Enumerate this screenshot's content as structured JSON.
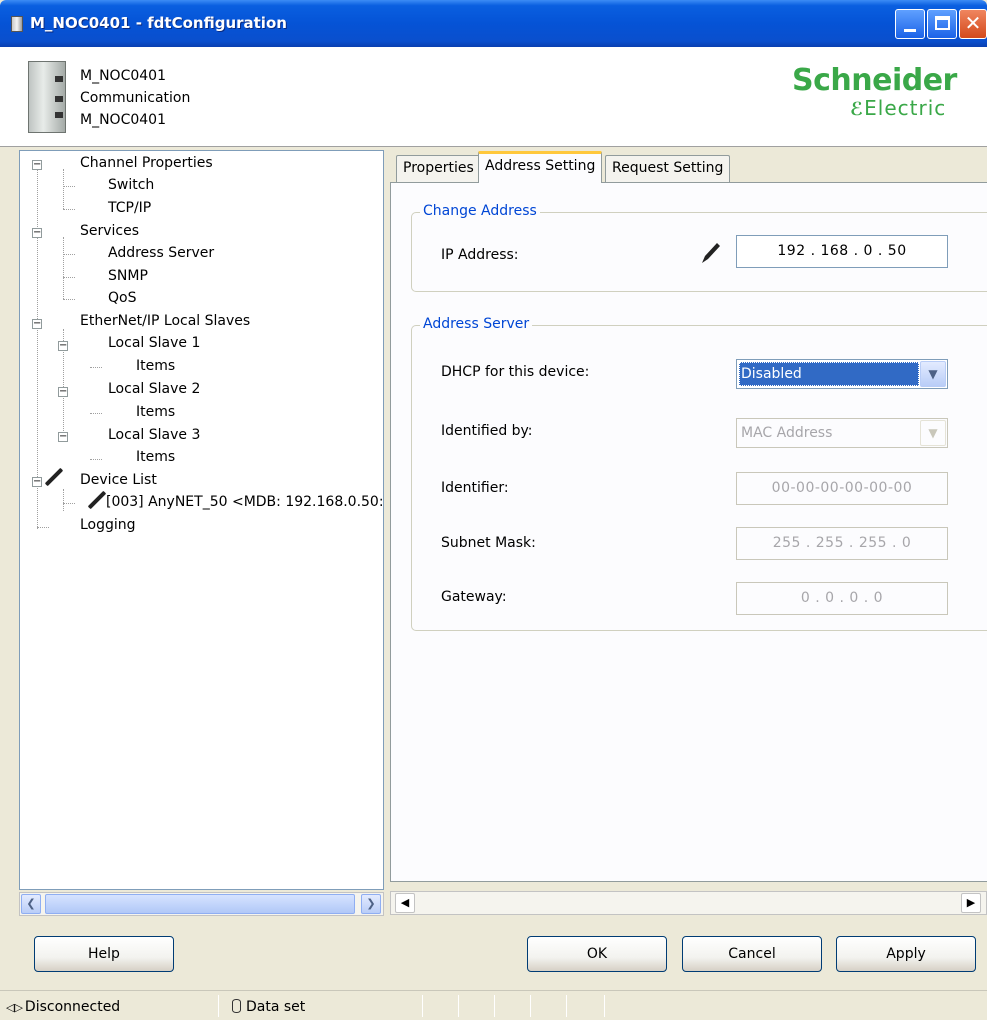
{
  "window": {
    "title": "M_NOC0401 - fdtConfiguration",
    "minimize_glyph": "_",
    "maximize_glyph": "□",
    "close_glyph": "✕"
  },
  "header": {
    "line1": "M_NOC0401",
    "line2": "Communication",
    "line3": "M_NOC0401",
    "logo_top": "Schneider",
    "logo_bottom": "Electric"
  },
  "tree": {
    "channel_properties": "Channel Properties",
    "switch": "Switch",
    "tcpip": "TCP/IP",
    "services": "Services",
    "address_server": "Address Server",
    "snmp": "SNMP",
    "qos": "QoS",
    "ethernetip_local_slaves": "EtherNet/IP Local Slaves",
    "local_slave_1": "Local Slave 1",
    "items_1": "Items",
    "local_slave_2": "Local Slave 2",
    "items_2": "Items",
    "local_slave_3": "Local Slave 3",
    "items_3": "Items",
    "device_list": "Device List",
    "device_003": "[003] AnyNET_50 <MDB: 192.168.0.50:",
    "logging": "Logging"
  },
  "tabs": {
    "properties": "Properties",
    "address_setting": "Address Setting",
    "request_setting": "Request Setting"
  },
  "change_address": {
    "group_title": "Change Address",
    "ip_label": "IP Address:",
    "ip_value": "192 . 168 . 0 . 50"
  },
  "address_server": {
    "group_title": "Address Server",
    "dhcp_label": "DHCP for this device:",
    "dhcp_value": "Disabled",
    "identified_by_label": "Identified by:",
    "identified_by_value": "MAC Address",
    "identifier_label": "Identifier:",
    "identifier_value": "00-00-00-00-00-00",
    "subnet_label": "Subnet Mask:",
    "subnet_value": "255 . 255 . 255 . 0",
    "gateway_label": "Gateway:",
    "gateway_value": "0 . 0 . 0 . 0"
  },
  "buttons": {
    "help": "Help",
    "ok": "OK",
    "cancel": "Cancel",
    "apply": "Apply"
  },
  "statusbar": {
    "connection": "Disconnected",
    "data": "Data set"
  },
  "icons": {
    "window": "fdt-window-icon",
    "edit": "pencil-icon",
    "db": "database-icon",
    "plug": "plug-icon"
  },
  "colors": {
    "titlebar": "#0553d6",
    "group_title": "#0046d5",
    "selection": "#316ac5",
    "logo": "#3aa848"
  }
}
